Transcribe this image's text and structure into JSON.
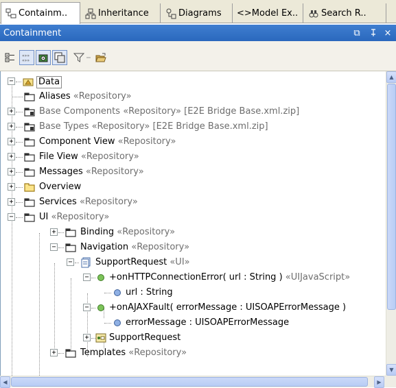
{
  "tabs": [
    {
      "label": "Containm..",
      "icon": "containment-tab-icon"
    },
    {
      "label": "Inheritance",
      "icon": "inheritance-tab-icon"
    },
    {
      "label": "Diagrams",
      "icon": "diagrams-tab-icon"
    },
    {
      "label": "<>Model Ex..",
      "icon": "model-explorer-tab-icon"
    },
    {
      "label": "Search R..",
      "icon": "search-results-tab-icon"
    }
  ],
  "panel": {
    "title": "Containment",
    "controls": {
      "restore": "⧉",
      "pin": "ᵖ",
      "close": "×"
    }
  },
  "toolbar": {
    "buttons": [
      "collapse-all",
      "show-stereotypes",
      "filter-packages",
      "show-diagrams",
      "filter",
      "open-folder"
    ]
  },
  "tree": {
    "root": {
      "label": "Data"
    },
    "items": [
      {
        "label": "Aliases",
        "stereotype": "«Repository»",
        "extra": ""
      },
      {
        "label": "Base Components",
        "stereotype": "«Repository»",
        "extra": "[E2E Bridge Base.xml.zip]"
      },
      {
        "label": "Base Types",
        "stereotype": "«Repository»",
        "extra": "[E2E Bridge Base.xml.zip]"
      },
      {
        "label": "Component View",
        "stereotype": "«Repository»",
        "extra": ""
      },
      {
        "label": "File View",
        "stereotype": "«Repository»",
        "extra": ""
      },
      {
        "label": "Messages",
        "stereotype": "«Repository»",
        "extra": ""
      },
      {
        "label": "Overview",
        "stereotype": "",
        "extra": ""
      },
      {
        "label": "Services",
        "stereotype": "«Repository»",
        "extra": ""
      },
      {
        "label": "UI",
        "stereotype": "«Repository»",
        "extra": ""
      },
      {
        "label": "Binding",
        "stereotype": "«Repository»",
        "extra": ""
      },
      {
        "label": "Navigation",
        "stereotype": "«Repository»",
        "extra": ""
      },
      {
        "label": "SupportRequest",
        "stereotype": "«UI»",
        "extra": ""
      },
      {
        "label": "+onHTTPConnectionError( url : String )",
        "stereotype": "«UIJavaScript»",
        "extra": ""
      },
      {
        "label": "url : String",
        "stereotype": "",
        "extra": ""
      },
      {
        "label": "+onAJAXFault( errorMessage : UISOAPErrorMessage )",
        "stereotype": "",
        "extra": ""
      },
      {
        "label": "errorMessage : UISOAPErrorMessage",
        "stereotype": "",
        "extra": ""
      },
      {
        "label": "SupportRequest",
        "stereotype": "",
        "extra": ""
      },
      {
        "label": "Templates",
        "stereotype": "«Repository»",
        "extra": ""
      }
    ]
  },
  "colors": {
    "titlebar": "#2f6fc4",
    "stereotype_grey": "#6d6d6d",
    "package_folder": "#7a6a45",
    "method_green": "#5aa53a",
    "attribute_blue": "#5a84c7"
  }
}
